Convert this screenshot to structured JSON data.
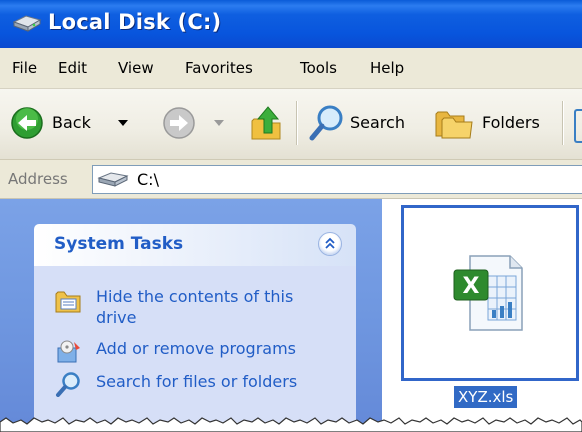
{
  "window": {
    "title": "Local Disk (C:)",
    "title_icon": "drive-icon"
  },
  "menu": {
    "items": [
      "File",
      "Edit",
      "View",
      "Favorites",
      "Tools",
      "Help"
    ]
  },
  "toolbar": {
    "back_label": "Back",
    "search_label": "Search",
    "folders_label": "Folders"
  },
  "address": {
    "label": "Address",
    "value": "C:\\"
  },
  "task_pane": {
    "title": "System Tasks",
    "items": [
      {
        "label": "Hide the contents of this drive",
        "icon": "folder-view-icon"
      },
      {
        "label": "Add or remove programs",
        "icon": "programs-icon"
      },
      {
        "label": "Search for files or folders",
        "icon": "search-icon"
      }
    ]
  },
  "files": [
    {
      "name": "XYZ.xls",
      "icon": "excel-file-icon",
      "selected": true
    }
  ],
  "colors": {
    "titlebar": "#0a55dd",
    "link": "#215dc6",
    "selection": "#316ac5",
    "task_pane_bg": "#6f97e0"
  }
}
